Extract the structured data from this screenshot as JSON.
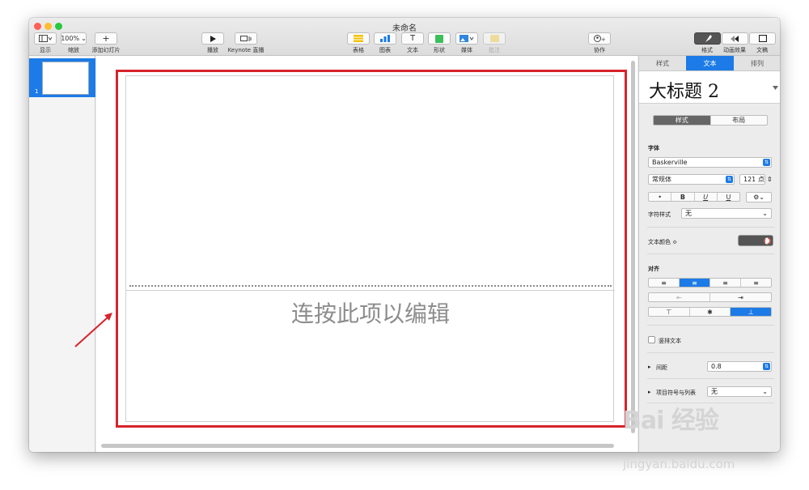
{
  "window": {
    "title": "未命名",
    "colors": {
      "close": "#fe5f57",
      "minimize": "#febc2e",
      "zoom": "#28c840"
    }
  },
  "toolbar": {
    "view_label": "显示",
    "zoom_value": "100%",
    "zoom_label": "缩放",
    "add_slide_icon": "+",
    "add_slide_label": "添加幻灯片",
    "play_label": "播放",
    "keynote_live_label": "Keynote 直播",
    "table_label": "表格",
    "chart_label": "图表",
    "text_label": "文本",
    "text_icon": "T",
    "shape_label": "形状",
    "media_label": "媒体",
    "comment_label": "批注",
    "collaborate_label": "协作",
    "format_label": "格式",
    "animate_label": "动画效果",
    "document_label": "文稿"
  },
  "navigator": {
    "slides": [
      {
        "number": "1"
      }
    ]
  },
  "slide": {
    "placeholder": "连按此项以编辑"
  },
  "inspector": {
    "tabs": [
      "样式",
      "文本",
      "排列"
    ],
    "paragraph_style": "大标题 2",
    "subtabs": [
      "样式",
      "布局"
    ],
    "font_section": "字体",
    "font_family": "Baskerville",
    "typeface": "常规体",
    "font_size": "121 点",
    "style_buttons": [
      "•",
      "B",
      "U",
      "U"
    ],
    "char_style_label": "字符样式",
    "char_style_value": "无",
    "text_color_label": "文本颜色 ≎",
    "text_color": "#555555",
    "alignment_label": "对齐",
    "vertical_text_label": "竖排文本",
    "spacing_label": "间距",
    "spacing_value": "0.8",
    "bullets_label": "项目符号与列表",
    "bullets_value": "无"
  },
  "watermark": {
    "logo": "Bai 经验",
    "url": "jingyan.baidu.com"
  },
  "accent_colors": {
    "blue": "#1c7be7",
    "red_box": "#d7232c"
  }
}
